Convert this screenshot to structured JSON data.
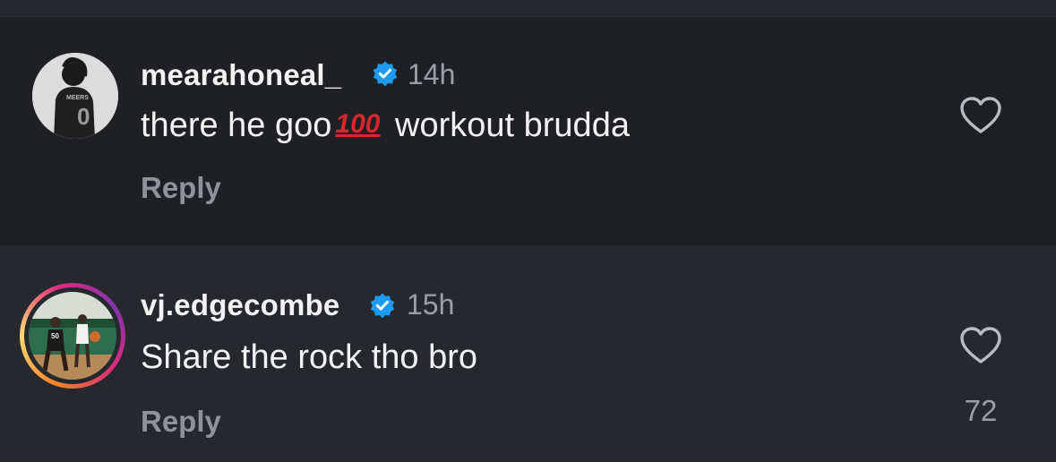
{
  "comments": [
    {
      "username": "mearahoneal_",
      "time": "14h",
      "text_before": "there he goo",
      "emoji": "100",
      "text_after": " workout brudda",
      "reply_label": "Reply",
      "likes": ""
    },
    {
      "username": "vj.edgecombe",
      "time": "15h",
      "text": "Share the rock tho bro",
      "reply_label": "Reply",
      "likes": "72"
    }
  ],
  "colors": {
    "background": "#1e2024",
    "verified_badge": "#1d9bf0",
    "emoji_100": "#d9262c"
  }
}
